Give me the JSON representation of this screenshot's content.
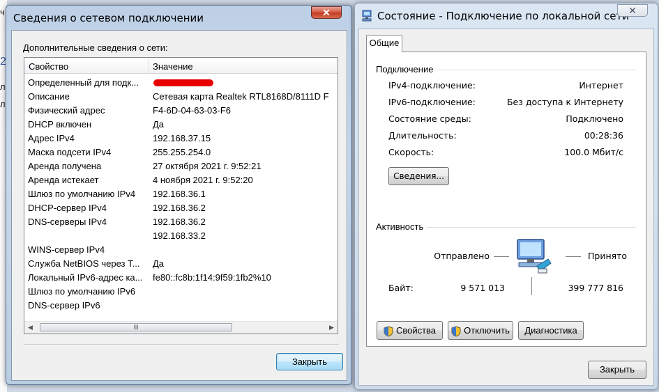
{
  "background": {
    "edge_chars": [
      "ч",
      "2",
      "л",
      "л"
    ]
  },
  "details_dialog": {
    "title": "Сведения о сетевом подключении",
    "close_glyph": "✕",
    "section_label": "Дополнительные сведения о сети:",
    "columns": [
      "Свойство",
      "Значение"
    ],
    "rows": [
      {
        "prop": "Определенный для подк...",
        "value": ""
      },
      {
        "prop": "Описание",
        "value": "Сетевая карта Realtek RTL8168D/8111D F"
      },
      {
        "prop": "Физический адрес",
        "value": "F4-6D-04-63-03-F6"
      },
      {
        "prop": "DHCP включен",
        "value": "Да"
      },
      {
        "prop": "Адрес IPv4",
        "value": "192.168.37.15"
      },
      {
        "prop": "Маска подсети IPv4",
        "value": "255.255.254.0"
      },
      {
        "prop": "Аренда получена",
        "value": "27 октября 2021 г. 9:52:21"
      },
      {
        "prop": "Аренда истекает",
        "value": "4 ноября 2021 г. 9:52:20"
      },
      {
        "prop": "Шлюз по умолчанию IPv4",
        "value": "192.168.36.1"
      },
      {
        "prop": "DHCP-сервер IPv4",
        "value": "192.168.36.2"
      },
      {
        "prop": "DNS-серверы IPv4",
        "value": "192.168.36.2"
      },
      {
        "prop": "",
        "value": "192.168.33.2"
      },
      {
        "prop": "WINS-сервер IPv4",
        "value": ""
      },
      {
        "prop": "Служба NetBIOS через Т...",
        "value": "Да"
      },
      {
        "prop": "Локальный IPv6-адрес ка...",
        "value": "fe80::fc8b:1f14:9f59:1fb2%10"
      },
      {
        "prop": "Шлюз по умолчанию IPv6",
        "value": ""
      },
      {
        "prop": "DNS-сервер IPv6",
        "value": ""
      }
    ],
    "scroll_left": "◀",
    "scroll_right": "▶",
    "scroll_grip": "III",
    "close_button": "Закрыть"
  },
  "status_dialog": {
    "title": "Состояние - Подключение по локальной сети",
    "close_glyph": "✕",
    "tab": "Общие",
    "connection": {
      "group_label": "Подключение",
      "rows": [
        {
          "label": "IPv4-подключение:",
          "value": "Интернет"
        },
        {
          "label": "IPv6-подключение:",
          "value": "Без доступа к Интернету"
        },
        {
          "label": "Состояние среды:",
          "value": "Подключено"
        },
        {
          "label": "Длительность:",
          "value": "00:28:36"
        },
        {
          "label": "Скорость:",
          "value": "100.0 Мбит/с"
        }
      ],
      "details_button": "Сведения..."
    },
    "activity": {
      "group_label": "Активность",
      "sent_label": "Отправлено",
      "received_label": "Принято",
      "bytes_label": "Байт:",
      "bytes_sent": "9 571 013",
      "bytes_received": "399 777 816"
    },
    "buttons": {
      "properties": "Свойства",
      "disable": "Отключить",
      "diagnose": "Диагностика",
      "close": "Закрыть"
    }
  }
}
